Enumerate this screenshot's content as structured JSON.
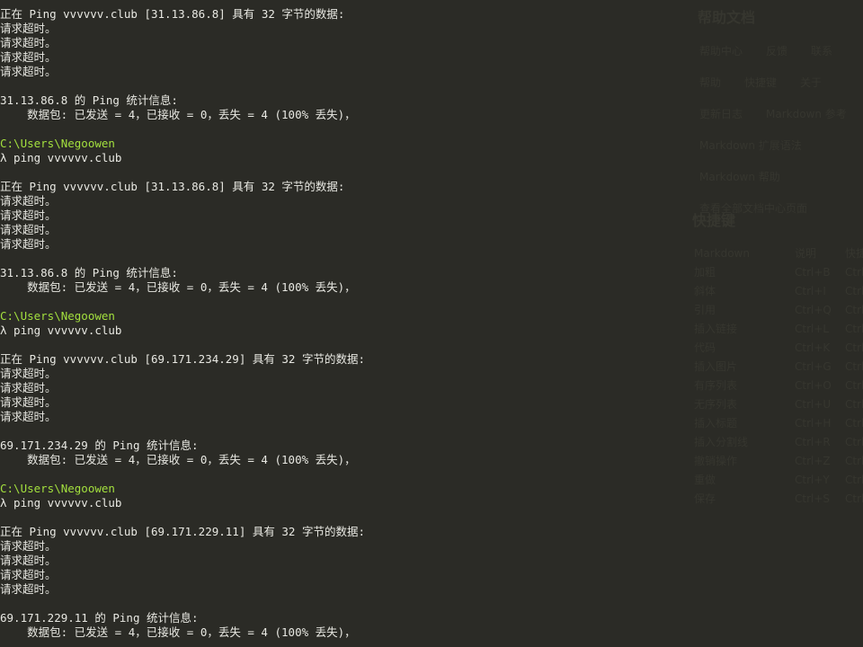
{
  "background_panel": {
    "heading_1": "帮助文档",
    "links": [
      "帮助中心",
      "反馈",
      "联系",
      "帮助",
      "快捷键",
      "关于",
      "更新日志",
      "Markdown 参考",
      "Markdown 扩展语法",
      "Markdown 帮助",
      "查看全部文档中心页面"
    ],
    "heading_2": "快捷键",
    "table_header": [
      "Markdown",
      "说明",
      "快捷键"
    ],
    "table_rows": [
      [
        "加粗",
        "Ctrl+B",
        "Ctrl+B"
      ],
      [
        "斜体",
        "Ctrl+I",
        "Ctrl+I"
      ],
      [
        "引用",
        "Ctrl+Q",
        "Ctrl+Q"
      ],
      [
        "插入链接",
        "Ctrl+L",
        "Ctrl+L"
      ],
      [
        "代码",
        "Ctrl+K",
        "Ctrl+K"
      ],
      [
        "插入图片",
        "Ctrl+G",
        "Ctrl+G"
      ],
      [
        "有序列表",
        "Ctrl+O",
        "Ctrl+O"
      ],
      [
        "无序列表",
        "Ctrl+U",
        "Ctrl+U"
      ],
      [
        "插入标题",
        "Ctrl+H",
        "Ctrl+H"
      ],
      [
        "插入分割线",
        "Ctrl+R",
        "Ctrl+R"
      ],
      [
        "撤销操作",
        "Ctrl+Z",
        "Ctrl+Z"
      ],
      [
        "重做",
        "Ctrl+Y",
        "Ctrl+Y"
      ],
      [
        "保存",
        "Ctrl+S",
        "Ctrl+S"
      ]
    ]
  },
  "terminal": {
    "lines": [
      {
        "text": "正在 Ping vvvvvv.club [31.13.86.8] 具有 32 字节的数据:",
        "kind": "output"
      },
      {
        "text": "请求超时。",
        "kind": "output"
      },
      {
        "text": "请求超时。",
        "kind": "output"
      },
      {
        "text": "请求超时。",
        "kind": "output"
      },
      {
        "text": "请求超时。",
        "kind": "output"
      },
      {
        "text": "",
        "kind": "output"
      },
      {
        "text": "31.13.86.8 的 Ping 统计信息:",
        "kind": "output"
      },
      {
        "text": "    数据包: 已发送 = 4，已接收 = 0，丢失 = 4 (100% 丢失)，",
        "kind": "output"
      },
      {
        "text": "",
        "kind": "output"
      },
      {
        "text": "C:\\Users\\Negoowen",
        "kind": "path"
      },
      {
        "text": "λ ping vvvvvv.club",
        "kind": "command"
      },
      {
        "text": "",
        "kind": "output"
      },
      {
        "text": "正在 Ping vvvvvv.club [31.13.86.8] 具有 32 字节的数据:",
        "kind": "output"
      },
      {
        "text": "请求超时。",
        "kind": "output"
      },
      {
        "text": "请求超时。",
        "kind": "output"
      },
      {
        "text": "请求超时。",
        "kind": "output"
      },
      {
        "text": "请求超时。",
        "kind": "output"
      },
      {
        "text": "",
        "kind": "output"
      },
      {
        "text": "31.13.86.8 的 Ping 统计信息:",
        "kind": "output"
      },
      {
        "text": "    数据包: 已发送 = 4，已接收 = 0，丢失 = 4 (100% 丢失)，",
        "kind": "output"
      },
      {
        "text": "",
        "kind": "output"
      },
      {
        "text": "C:\\Users\\Negoowen",
        "kind": "path"
      },
      {
        "text": "λ ping vvvvvv.club",
        "kind": "command"
      },
      {
        "text": "",
        "kind": "output"
      },
      {
        "text": "正在 Ping vvvvvv.club [69.171.234.29] 具有 32 字节的数据:",
        "kind": "output"
      },
      {
        "text": "请求超时。",
        "kind": "output"
      },
      {
        "text": "请求超时。",
        "kind": "output"
      },
      {
        "text": "请求超时。",
        "kind": "output"
      },
      {
        "text": "请求超时。",
        "kind": "output"
      },
      {
        "text": "",
        "kind": "output"
      },
      {
        "text": "69.171.234.29 的 Ping 统计信息:",
        "kind": "output"
      },
      {
        "text": "    数据包: 已发送 = 4，已接收 = 0，丢失 = 4 (100% 丢失)，",
        "kind": "output"
      },
      {
        "text": "",
        "kind": "output"
      },
      {
        "text": "C:\\Users\\Negoowen",
        "kind": "path"
      },
      {
        "text": "λ ping vvvvvv.club",
        "kind": "command"
      },
      {
        "text": "",
        "kind": "output"
      },
      {
        "text": "正在 Ping vvvvvv.club [69.171.229.11] 具有 32 字节的数据:",
        "kind": "output"
      },
      {
        "text": "请求超时。",
        "kind": "output"
      },
      {
        "text": "请求超时。",
        "kind": "output"
      },
      {
        "text": "请求超时。",
        "kind": "output"
      },
      {
        "text": "请求超时。",
        "kind": "output"
      },
      {
        "text": "",
        "kind": "output"
      },
      {
        "text": "69.171.229.11 的 Ping 统计信息:",
        "kind": "output"
      },
      {
        "text": "    数据包: 已发送 = 4，已接收 = 0，丢失 = 4 (100% 丢失)，",
        "kind": "output"
      }
    ]
  },
  "colors": {
    "background": "#2b2b26",
    "text": "#e8e8e2",
    "path": "#a3e03e",
    "faint_panel_text": "#36362f"
  }
}
